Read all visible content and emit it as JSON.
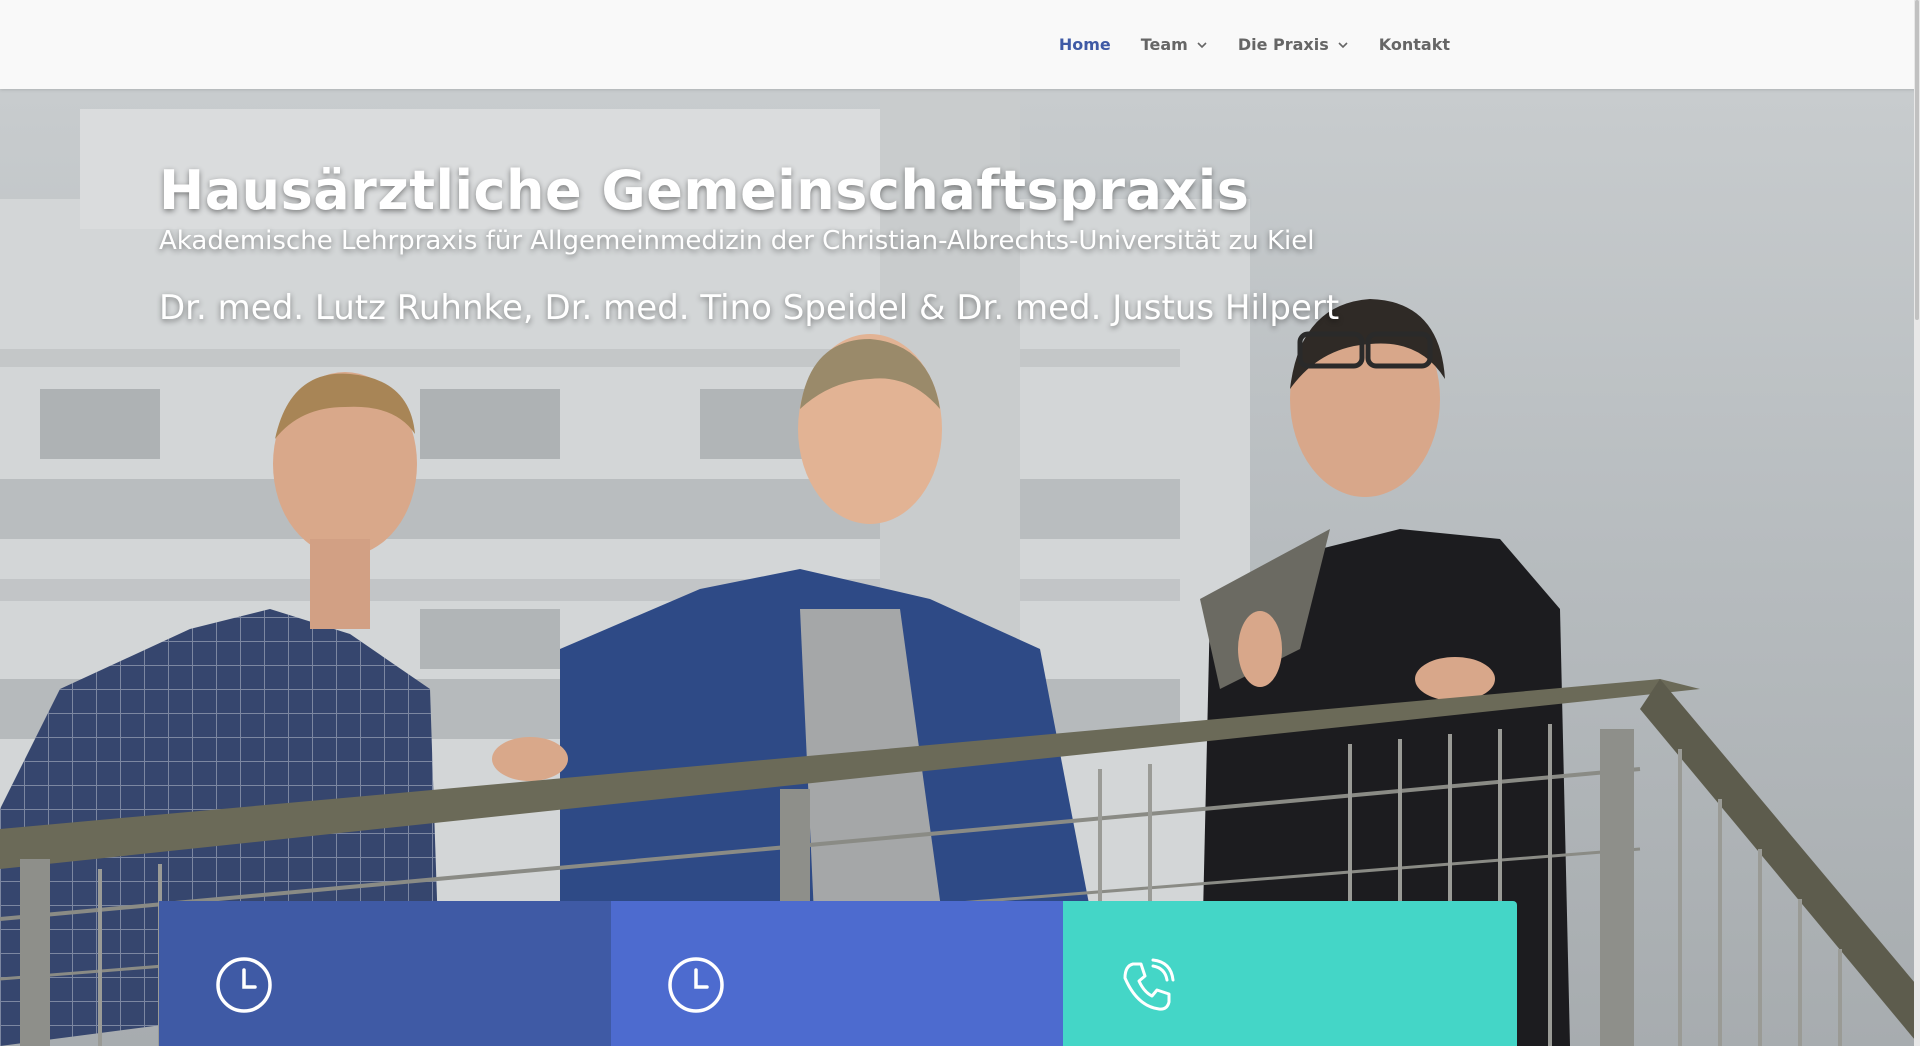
{
  "nav": {
    "items": [
      {
        "label": "Home",
        "active": true,
        "has_dropdown": false
      },
      {
        "label": "Team",
        "active": false,
        "has_dropdown": true
      },
      {
        "label": "Die Praxis",
        "active": false,
        "has_dropdown": true
      },
      {
        "label": "Kontakt",
        "active": false,
        "has_dropdown": false
      }
    ]
  },
  "hero": {
    "title": "Hausärztliche Gemeinschaftspraxis",
    "subtitle": "Akademische Lehrpraxis für Allgemeinmedizin der Christian-Albrechts-Universität zu Kiel",
    "doctors": "Dr. med. Lutz Ruhnke, Dr. med. Tino Speidel & Dr. med. Justus Hilpert"
  },
  "boxes": [
    {
      "icon": "clock-icon",
      "color": "#3f5aa5"
    },
    {
      "icon": "clock-icon",
      "color": "#4d6bcf"
    },
    {
      "icon": "phone-icon",
      "color": "#44d6c7"
    }
  ],
  "colors": {
    "accent": "#3f5aa5",
    "nav_text": "#666666",
    "teal": "#44d6c7"
  }
}
